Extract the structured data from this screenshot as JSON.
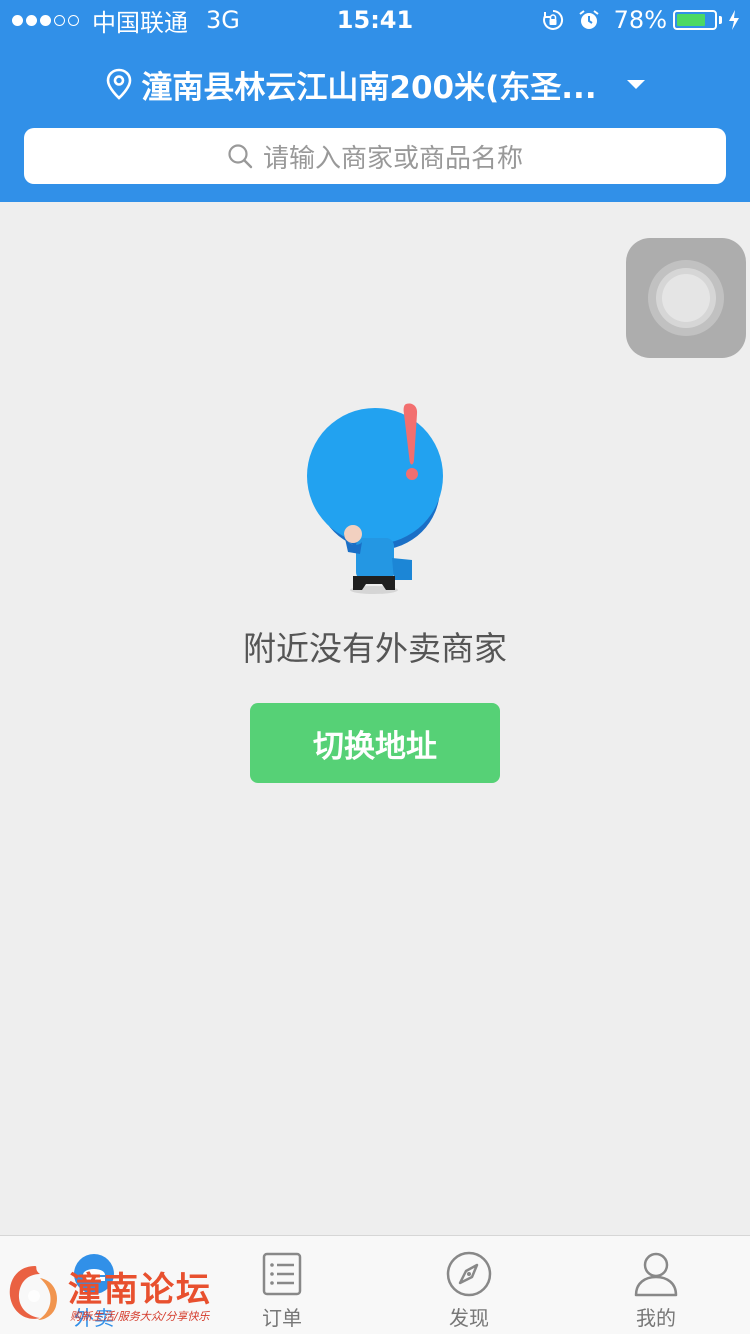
{
  "status_bar": {
    "signal_full": 3,
    "signal_total": 5,
    "carrier": "中国联通",
    "network": "3G",
    "time": "15:41",
    "battery_percent_text": "78%",
    "battery_level": 0.78
  },
  "header": {
    "location": "潼南县林云江山南200米(东圣...",
    "search_placeholder": "请输入商家或商品名称"
  },
  "empty_state": {
    "message": "附近没有外卖商家",
    "button_label": "切换地址"
  },
  "tabs": [
    {
      "label": "外卖",
      "icon": "takeout-icon",
      "active": true
    },
    {
      "label": "订单",
      "icon": "order-list-icon",
      "active": false
    },
    {
      "label": "发现",
      "icon": "compass-icon",
      "active": false
    },
    {
      "label": "我的",
      "icon": "user-icon",
      "active": false
    }
  ],
  "watermark": {
    "title": "潼南论坛",
    "subtitle": "购新生活/服务大众/分享快乐"
  },
  "colors": {
    "primary": "#3190e8",
    "button_green": "#56d176",
    "background": "#eeeeee"
  }
}
